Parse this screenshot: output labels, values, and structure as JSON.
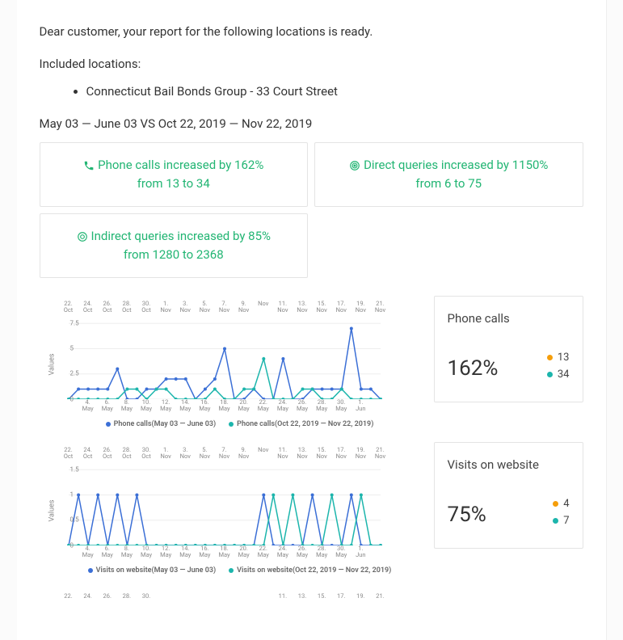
{
  "intro": "Dear customer, your report for the following locations is ready.",
  "locations_label": "Included locations:",
  "locations": [
    "Connecticut Bail Bonds Group - 33 Court Street"
  ],
  "date_range": "May 03 — June 03 VS Oct 22, 2019 — Nov 22, 2019",
  "cards": [
    {
      "icon": "phone-icon",
      "line1": "Phone calls increased by 162%",
      "line2": "from 13 to 34"
    },
    {
      "icon": "target-icon",
      "line1": "Direct queries increased by 1150%",
      "line2": "from 6 to 75"
    },
    {
      "icon": "compass-icon",
      "line1": "Indirect queries increased by 85%",
      "line2": "from 1280 to 2368"
    }
  ],
  "yaxis_label": "Values",
  "chart_data": [
    {
      "id": "phone_calls",
      "title_box": "Phone calls",
      "pct": "162%",
      "legend_box": [
        {
          "color": "orange",
          "value": "13"
        },
        {
          "color": "teal",
          "value": "34"
        }
      ],
      "top_ticks": [
        "22. Oct",
        "24. Oct",
        "26. Oct",
        "28. Oct",
        "30. Oct",
        "1. Nov",
        "3. Nov",
        "5. Nov",
        "7. Nov",
        "9. Nov",
        "Nov",
        "11. Nov",
        "13. Nov",
        "15. Nov",
        "17. Nov",
        "19. Nov",
        "21. Nov"
      ],
      "bottom_ticks": [
        "4. May",
        "6. May",
        "8. May",
        "10. May",
        "12. May",
        "14. May",
        "16. May",
        "18. May",
        "20. May",
        "22. May",
        "24. May",
        "26. May",
        "28. May",
        "30. May",
        "1. Jun"
      ],
      "y_ticks": [
        "0",
        "2.5",
        "5",
        "7.5"
      ],
      "series": [
        {
          "name": "Phone calls(May 03 — June 03)",
          "color": "#3b6fd6",
          "values": [
            0,
            1,
            1,
            1,
            1,
            3,
            0,
            0,
            1,
            1,
            2,
            2,
            2,
            0,
            1,
            2,
            5,
            0,
            0,
            1,
            0,
            0,
            4,
            0,
            0,
            1,
            1,
            1,
            1,
            7,
            1,
            1,
            0
          ]
        },
        {
          "name": "Phone calls(Oct 22, 2019 — Nov 22, 2019)",
          "color": "#1cb5ac",
          "values": [
            0,
            0,
            0,
            0,
            0,
            0,
            1,
            1,
            0,
            1,
            1,
            0,
            0,
            0,
            0,
            1,
            0,
            0,
            1,
            1,
            4,
            0,
            0,
            0,
            1,
            1,
            0,
            0,
            1,
            0,
            0,
            0,
            0
          ]
        }
      ],
      "ymax": 8
    },
    {
      "id": "visits",
      "title_box": "Visits on website",
      "pct": "75%",
      "legend_box": [
        {
          "color": "orange",
          "value": "4"
        },
        {
          "color": "teal",
          "value": "7"
        }
      ],
      "top_ticks": [
        "22. Oct",
        "24. Oct",
        "26. Oct",
        "28. Oct",
        "30. Oct",
        "1. Nov",
        "3. Nov",
        "5. Nov",
        "7. Nov",
        "9. Nov",
        "Nov",
        "11. Nov",
        "13. Nov",
        "15. Nov",
        "17. Nov",
        "19. Nov",
        "21. Nov"
      ],
      "bottom_ticks": [
        "4. May",
        "6. May",
        "8. May",
        "10. May",
        "12. May",
        "14. May",
        "16. May",
        "18. May",
        "20. May",
        "22. May",
        "24. May",
        "26. May",
        "28. May",
        "30. May",
        "1. Jun"
      ],
      "y_ticks": [
        "0",
        "0.5",
        "1",
        "1.5"
      ],
      "series": [
        {
          "name": "Visits on website(May 03 — June 03)",
          "color": "#3b6fd6",
          "values": [
            0,
            1,
            0,
            1,
            0,
            1,
            0,
            1,
            0,
            0,
            0,
            0,
            0,
            0,
            0,
            0,
            0,
            0,
            0,
            0,
            1,
            0,
            0,
            0,
            0,
            1,
            0,
            0,
            0,
            1,
            0,
            0,
            0
          ]
        },
        {
          "name": "Visits on website(Oct 22, 2019 — Nov 22, 2019)",
          "color": "#1cb5ac",
          "values": [
            0,
            0,
            0,
            0,
            0,
            0,
            0,
            0,
            0,
            0,
            0,
            0,
            0,
            0,
            0,
            0,
            0,
            0,
            0,
            0,
            0,
            1,
            0,
            1,
            0,
            0,
            0,
            1,
            0,
            0,
            1,
            0,
            0
          ]
        }
      ],
      "ymax": 1.6
    },
    {
      "id": "partial",
      "title_box": "",
      "pct": "",
      "legend_box": [],
      "top_ticks": [
        "22.",
        "24.",
        "26.",
        "28.",
        "30.",
        "",
        "",
        "",
        "",
        "",
        "",
        "11.",
        "13.",
        "15.",
        "17.",
        "19.",
        "21."
      ],
      "bottom_ticks": [],
      "y_ticks": [],
      "series": [],
      "ymax": 1
    }
  ]
}
